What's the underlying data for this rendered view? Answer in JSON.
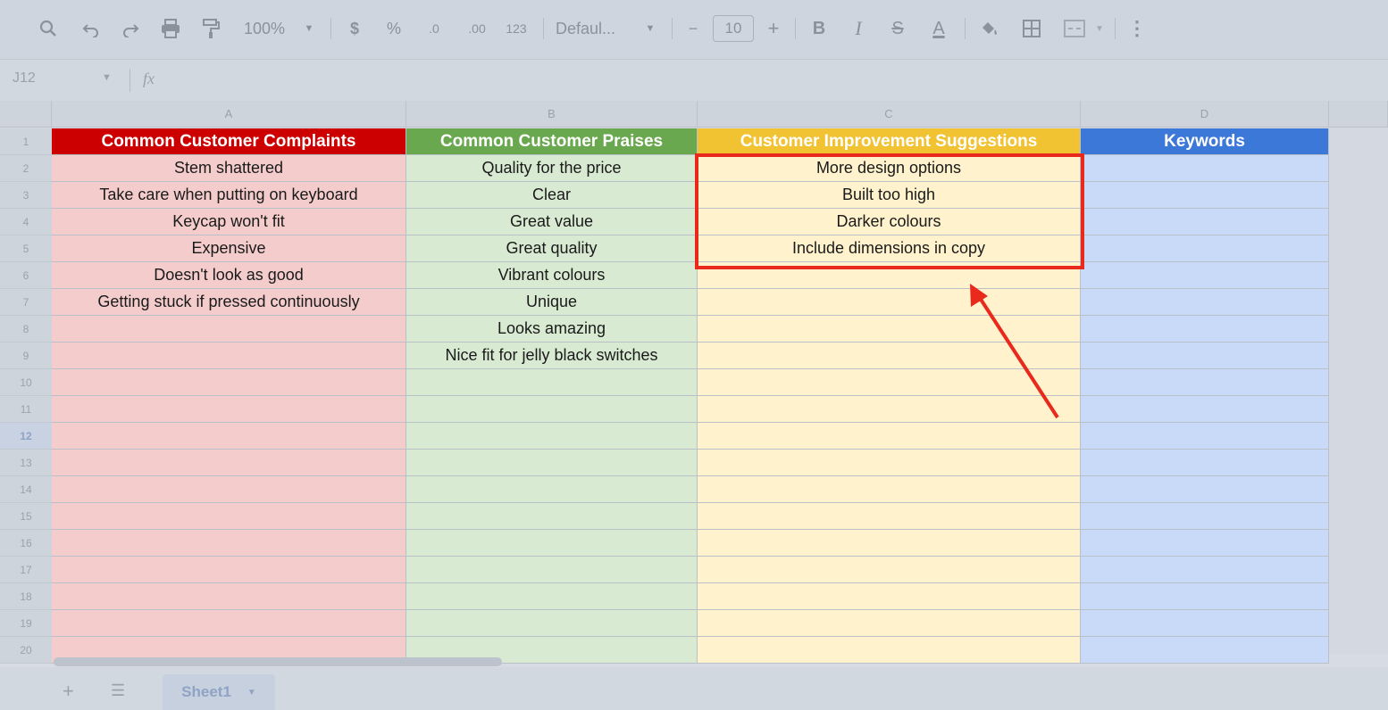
{
  "toolbar": {
    "zoom": "100%",
    "currency": "$",
    "percent": "%",
    "dec_decrease": ".0",
    "dec_increase": ".00",
    "format_123": "123",
    "font": "Defaul...",
    "font_size": "10",
    "bold": "B",
    "italic": "I",
    "strike": "S",
    "text_color": "A",
    "minus": "−",
    "plus": "+"
  },
  "formula_bar": {
    "name_box": "J12",
    "fx": "fx"
  },
  "columns": [
    "A",
    "B",
    "C",
    "D"
  ],
  "rows": [
    "1",
    "2",
    "3",
    "4",
    "5",
    "6",
    "7",
    "8",
    "9",
    "10",
    "11",
    "12",
    "13",
    "14",
    "15",
    "16",
    "17",
    "18",
    "19",
    "20"
  ],
  "headers": [
    "Common Customer Complaints",
    "Common Customer Praises",
    "Customer Improvement Suggestions",
    "Keywords"
  ],
  "complaints": [
    "Stem shattered",
    "Take care when putting on keyboard",
    "Keycap won't fit",
    "Expensive",
    "Doesn't look as good",
    "Getting stuck if pressed continuously"
  ],
  "praises": [
    "Quality for the price",
    "Clear",
    "Great value",
    "Great quality",
    "Vibrant colours",
    "Unique",
    "Looks amazing",
    "Nice fit for jelly black switches"
  ],
  "suggestions": [
    "More design options",
    "Built too high",
    "Darker colours",
    "Include dimensions in copy"
  ],
  "keywords": [],
  "sheet_tab": {
    "label": "Sheet1"
  },
  "colors": {
    "header_red": "#cc0000",
    "header_green": "#6aa84f",
    "header_yellow": "#f1c232",
    "header_blue": "#3c78d8",
    "fill_red": "#f4cccc",
    "fill_green": "#d9ead3",
    "fill_yellow": "#fff2cc",
    "fill_blue": "#c9daf8",
    "annotation": "#e8291c"
  }
}
